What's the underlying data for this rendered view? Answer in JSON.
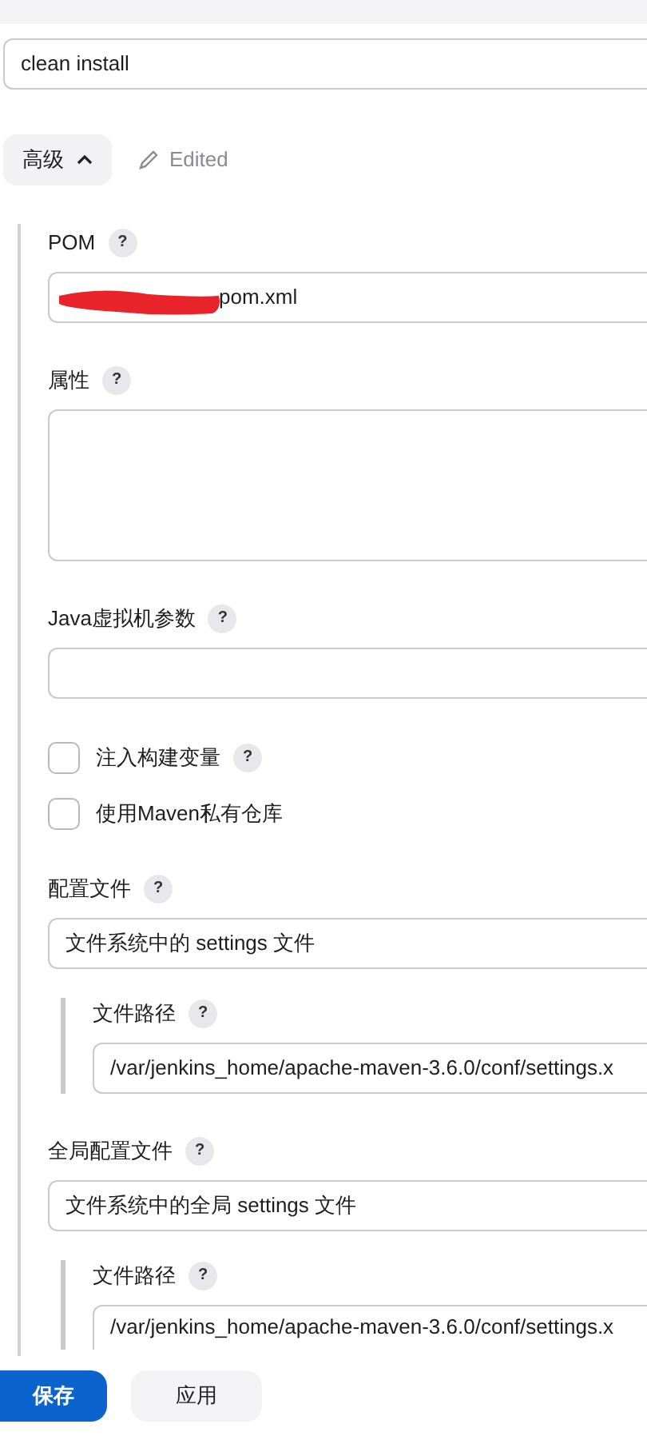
{
  "goals_field": {
    "value": "clean install"
  },
  "advanced": {
    "label": "高级",
    "expanded": true,
    "edited_label": "Edited"
  },
  "fields": [
    {
      "kind": "text",
      "label": "POM",
      "help": "?",
      "value": "pom.xml",
      "redacted": true
    },
    {
      "kind": "textarea",
      "label": "属性",
      "help": "?"
    },
    {
      "kind": "text",
      "label": "Java虚拟机参数",
      "help": "?"
    },
    {
      "kind": "checkbox",
      "label": "注入构建变量",
      "help": "?",
      "checked": false
    },
    {
      "kind": "checkbox",
      "label": "使用Maven私有仓库",
      "checked": false
    },
    {
      "kind": "select",
      "label": "配置文件",
      "help": "?",
      "value": "文件系统中的 settings 文件",
      "children": [
        {
          "kind": "text",
          "label": "文件路径",
          "help": "?",
          "value": "/var/jenkins_home/apache-maven-3.6.0/conf/settings.x"
        }
      ]
    },
    {
      "kind": "select",
      "label": "全局配置文件",
      "help": "?",
      "value": "文件系统中的全局 settings 文件",
      "children": [
        {
          "kind": "text",
          "label": "文件路径",
          "help": "?",
          "value": "/var/jenkins_home/apache-maven-3.6.0/conf/settings.x"
        }
      ]
    }
  ],
  "buttons": [
    {
      "label": "保存",
      "kind": "primary"
    },
    {
      "label": "应用",
      "kind": "secondary"
    }
  ]
}
